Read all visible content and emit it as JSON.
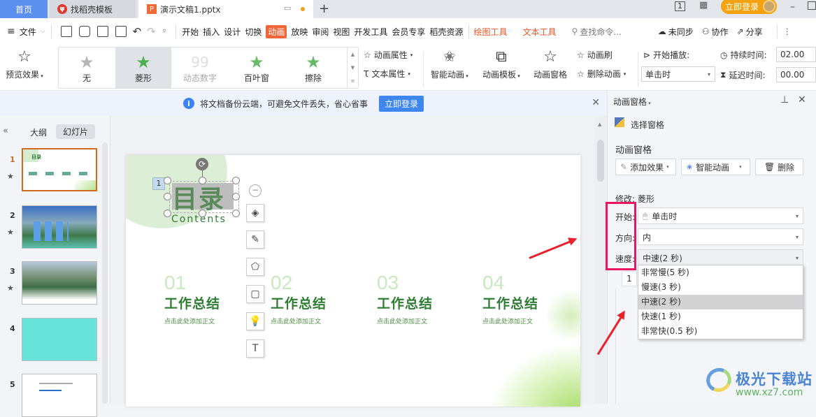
{
  "titlebar": {
    "tabs": [
      {
        "label": "首页"
      },
      {
        "label": "找稻壳模板"
      },
      {
        "label": "演示文稿1.pptx"
      }
    ],
    "new_tab": "+",
    "login": "立即登录",
    "page_indicator": "1"
  },
  "menubar": {
    "file": "文件",
    "items": [
      "开始",
      "插入",
      "设计",
      "切换",
      "动画",
      "放映",
      "审阅",
      "视图",
      "开发工具",
      "会员专享",
      "稻壳资源"
    ],
    "active": "动画",
    "tool_tabs": [
      "绘图工具",
      "文本工具"
    ],
    "search_placeholder": "查找命令...",
    "sync": "未同步",
    "collab": "协作",
    "share": "分享"
  },
  "ribbon": {
    "preview": "预览效果",
    "gallery": [
      {
        "label": "无"
      },
      {
        "label": "菱形"
      },
      {
        "label": "动态数字"
      },
      {
        "label": "百叶窗"
      },
      {
        "label": "擦除"
      }
    ],
    "anim_props": "动画属性",
    "text_props": "文本属性",
    "smart_anim": "智能动画",
    "anim_template": "动画模板",
    "anim_pane": "动画窗格",
    "anim_brush": "动画刷",
    "delete_anim": "删除动画",
    "start_play_label": "开始播放:",
    "start_play_value": "单击时",
    "duration_label": "持续时间:",
    "duration_value": "02.00",
    "delay_label": "延迟时间:",
    "delay_value": "00.00"
  },
  "notice": {
    "text": "将文档备份云端，可避免文件丢失，省心省事",
    "button": "立即登录"
  },
  "leftpanel": {
    "tabs": [
      "大纲",
      "幻灯片"
    ],
    "active_tab": "幻灯片",
    "slides": [
      {
        "num": "1",
        "has_anim": true,
        "selected": true
      },
      {
        "num": "2",
        "has_anim": true
      },
      {
        "num": "3",
        "has_anim": true
      },
      {
        "num": "4",
        "has_anim": false
      },
      {
        "num": "5",
        "has_anim": false
      }
    ]
  },
  "slide": {
    "title": "目录",
    "subtitle": "Contents",
    "anim_tag": "1",
    "sections": [
      {
        "num": "01",
        "title": "工作总结",
        "body": "点击此处添加正文"
      },
      {
        "num": "02",
        "title": "工作总结",
        "body": "点击此处添加正文"
      },
      {
        "num": "03",
        "title": "工作总结",
        "body": "点击此处添加正文"
      },
      {
        "num": "04",
        "title": "工作总结",
        "body": "点击此处添加正文"
      }
    ]
  },
  "rightpane": {
    "title": "动画窗格",
    "select_pane": "选择窗格",
    "section_title": "动画窗格",
    "add_effect": "添加效果",
    "smart_anim": "智能动画",
    "delete": "删除",
    "modify": "修改: 菱形",
    "start_label": "开始:",
    "start_value": "单击时",
    "direction_label": "方向:",
    "direction_value": "内",
    "speed_label": "速度:",
    "speed_value": "中速(2 秒)",
    "speed_options": [
      "非常慢(5 秒)",
      "慢速(3 秒)",
      "中速(2 秒)",
      "快速(1 秒)",
      "非常快(0.5 秒)"
    ],
    "selected_speed_index": 2,
    "list_item_num": "1"
  },
  "watermark": {
    "name": "极光下载站",
    "url": "www.xz7.com"
  },
  "colors": {
    "accent": "#f0663b",
    "highlight": "#e8165f",
    "arrow": "#e8202a",
    "slide_green": "#2e7d32"
  }
}
